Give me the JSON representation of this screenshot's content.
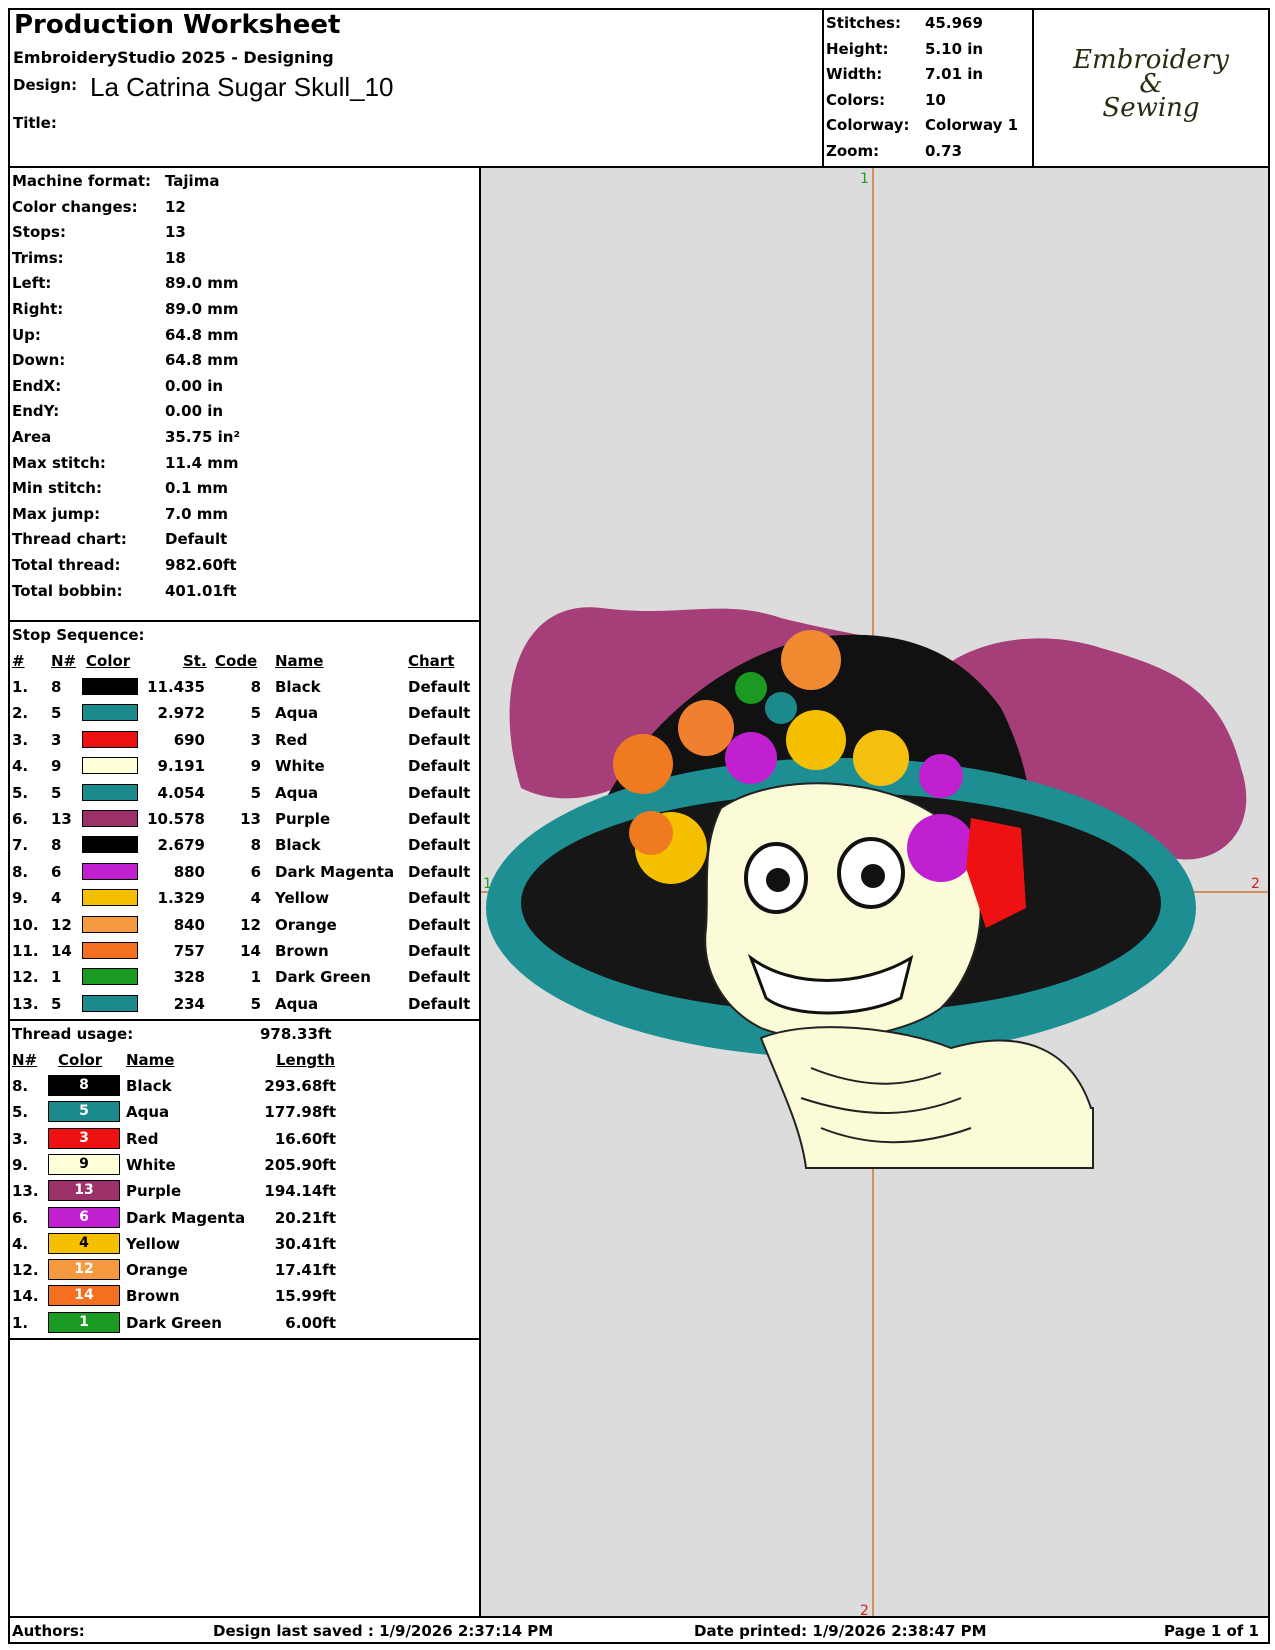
{
  "header": {
    "title": "Production Worksheet",
    "software": "EmbroideryStudio 2025 - Designing",
    "design_label": "Design:",
    "design_name": "La Catrina Sugar Skull_10",
    "title_label": "Title:"
  },
  "summary": [
    {
      "label": "Stitches:",
      "value": "45.969"
    },
    {
      "label": "Height:",
      "value": "5.10 in"
    },
    {
      "label": "Width:",
      "value": "7.01 in"
    },
    {
      "label": "Colors:",
      "value": "10"
    },
    {
      "label": "Colorway:",
      "value": "Colorway 1"
    },
    {
      "label": "Zoom:",
      "value": "0.73"
    }
  ],
  "logo": {
    "line1": "Embroidery",
    "line2": "&",
    "line3": "Sewing"
  },
  "specs": [
    {
      "label": "Machine format:",
      "value": "Tajima"
    },
    {
      "label": "Color changes:",
      "value": "12"
    },
    {
      "label": "Stops:",
      "value": "13"
    },
    {
      "label": "Trims:",
      "value": "18"
    },
    {
      "label": "Left:",
      "value": "89.0 mm"
    },
    {
      "label": "Right:",
      "value": "89.0 mm"
    },
    {
      "label": "Up:",
      "value": "64.8 mm"
    },
    {
      "label": "Down:",
      "value": "64.8 mm"
    },
    {
      "label": "EndX:",
      "value": "0.00 in"
    },
    {
      "label": "EndY:",
      "value": "0.00 in"
    },
    {
      "label": "Area",
      "value": " 35.75 in²"
    },
    {
      "label": "Max stitch:",
      "value": "11.4 mm"
    },
    {
      "label": "Min stitch:",
      "value": "0.1 mm"
    },
    {
      "label": "Max jump:",
      "value": "7.0 mm"
    },
    {
      "label": "Thread chart:",
      "value": "Default"
    },
    {
      "label": "Total thread:",
      "value": "982.60ft"
    },
    {
      "label": "Total bobbin:",
      "value": "401.01ft"
    }
  ],
  "stop_sequence": {
    "title": "Stop Sequence:",
    "headers": {
      "num": "#",
      "n": "N#",
      "color": "Color",
      "st": "St.",
      "code": "Code",
      "name": "Name",
      "chart": "Chart"
    },
    "rows": [
      {
        "num": "1.",
        "n": "8",
        "color": "#000000",
        "st": "11.435",
        "code": "8",
        "name": "Black",
        "chart": "Default"
      },
      {
        "num": "2.",
        "n": "5",
        "color": "#1a8a8c",
        "st": "2.972",
        "code": "5",
        "name": "Aqua",
        "chart": "Default"
      },
      {
        "num": "3.",
        "n": "3",
        "color": "#ee1111",
        "st": "690",
        "code": "3",
        "name": "Red",
        "chart": "Default"
      },
      {
        "num": "4.",
        "n": "9",
        "color": "#ffffd8",
        "st": "9.191",
        "code": "9",
        "name": "White",
        "chart": "Default"
      },
      {
        "num": "5.",
        "n": "5",
        "color": "#1a8a8c",
        "st": "4.054",
        "code": "5",
        "name": "Aqua",
        "chart": "Default"
      },
      {
        "num": "6.",
        "n": "13",
        "color": "#9c3068",
        "st": "10.578",
        "code": "13",
        "name": "Purple",
        "chart": "Default"
      },
      {
        "num": "7.",
        "n": "8",
        "color": "#000000",
        "st": "2.679",
        "code": "8",
        "name": "Black",
        "chart": "Default"
      },
      {
        "num": "8.",
        "n": "6",
        "color": "#c020d0",
        "st": "880",
        "code": "6",
        "name": "Dark Magenta",
        "chart": "Default"
      },
      {
        "num": "9.",
        "n": "4",
        "color": "#f5c000",
        "st": "1.329",
        "code": "4",
        "name": "Yellow",
        "chart": "Default"
      },
      {
        "num": "10.",
        "n": "12",
        "color": "#f59a40",
        "st": "840",
        "code": "12",
        "name": "Orange",
        "chart": "Default"
      },
      {
        "num": "11.",
        "n": "14",
        "color": "#f27020",
        "st": "757",
        "code": "14",
        "name": "Brown",
        "chart": "Default"
      },
      {
        "num": "12.",
        "n": "1",
        "color": "#1a9a20",
        "st": "328",
        "code": "1",
        "name": "Dark Green",
        "chart": "Default"
      },
      {
        "num": "13.",
        "n": "5",
        "color": "#1a8a8c",
        "st": "234",
        "code": "5",
        "name": "Aqua",
        "chart": "Default"
      }
    ]
  },
  "thread_usage": {
    "title": "Thread usage:",
    "total": "978.33ft",
    "headers": {
      "n": "N#",
      "color": "Color",
      "name": "Name",
      "length": "Length"
    },
    "rows": [
      {
        "n": "8.",
        "code": "8",
        "color": "#000000",
        "text_color": "#ffffff",
        "name": "Black",
        "length": "293.68ft"
      },
      {
        "n": "5.",
        "code": "5",
        "color": "#1a8a8c",
        "text_color": "#ffffff",
        "name": "Aqua",
        "length": "177.98ft"
      },
      {
        "n": "3.",
        "code": "3",
        "color": "#ee1111",
        "text_color": "#ffffff",
        "name": "Red",
        "length": "16.60ft"
      },
      {
        "n": "9.",
        "code": "9",
        "color": "#ffffd8",
        "text_color": "#000000",
        "name": "White",
        "length": "205.90ft"
      },
      {
        "n": "13.",
        "code": "13",
        "color": "#9c3068",
        "text_color": "#ffffff",
        "name": "Purple",
        "length": "194.14ft"
      },
      {
        "n": "6.",
        "code": "6",
        "color": "#c020d0",
        "text_color": "#ffffff",
        "name": "Dark Magenta",
        "length": "20.21ft"
      },
      {
        "n": "4.",
        "code": "4",
        "color": "#f5c000",
        "text_color": "#000000",
        "name": "Yellow",
        "length": "30.41ft"
      },
      {
        "n": "12.",
        "code": "12",
        "color": "#f59a40",
        "text_color": "#ffffff",
        "name": "Orange",
        "length": "17.41ft"
      },
      {
        "n": "14.",
        "code": "14",
        "color": "#f27020",
        "text_color": "#ffffff",
        "name": "Brown",
        "length": "15.99ft"
      },
      {
        "n": "1.",
        "code": "1",
        "color": "#1a9a20",
        "text_color": "#ffffff",
        "name": "Dark Green",
        "length": "6.00ft"
      }
    ]
  },
  "preview": {
    "marker_top": "1",
    "marker_bottom": "2",
    "marker_left": "1",
    "marker_right": "2"
  },
  "footer": {
    "authors": "Authors:",
    "saved": "Design last saved : 1/9/2026 2:37:14 PM",
    "printed": "Date printed: 1/9/2026 2:38:47 PM",
    "page": "Page 1 of 1"
  }
}
